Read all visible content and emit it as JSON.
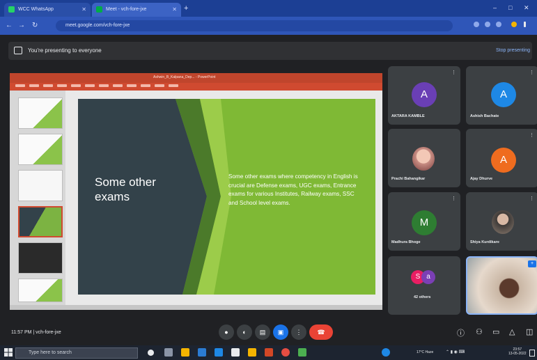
{
  "browser": {
    "tabs": [
      {
        "label": "WCC WhatsApp"
      },
      {
        "label": "Meet - vch-fore-jxe"
      }
    ],
    "url": "meet.google.com/vch-fore-jxe"
  },
  "presenting": {
    "text": "You're presenting to everyone",
    "stop_label": "Stop presenting"
  },
  "powerpoint": {
    "title_text": "Ashwin_B_Kalpana_Dep... - PowerPoint",
    "accent": "#c0452c"
  },
  "slide": {
    "title": "Some other exams",
    "body": "Some other exams where competency in English is crucial are Defense exams, UGC exams, Entrance exams for various Institutes, Railway exams, SSC and School level exams."
  },
  "participants": [
    {
      "name": "AKTARA KAMBLE",
      "initial": "A",
      "color": "#6a3fb5",
      "type": "avatar"
    },
    {
      "name": "Ashish Bachate",
      "initial": "A",
      "color": "#1e88e5",
      "type": "avatar"
    },
    {
      "name": "Prachi Bahangikar",
      "initial": "",
      "color": "#c98e84",
      "type": "photo"
    },
    {
      "name": "Ajay Dhurve",
      "initial": "A",
      "color": "#ef6c1f",
      "type": "avatar"
    },
    {
      "name": "Madhura Bhoge",
      "initial": "M",
      "color": "#2e7d32",
      "type": "avatar"
    },
    {
      "name": "Shiya Kurdikare",
      "initial": "",
      "color": "#8a7a6e",
      "type": "photo"
    },
    {
      "name": "42 others",
      "initial": "S",
      "color": "#e91e63",
      "type": "group",
      "initial2": "a",
      "color2": "#7b3fb5"
    }
  ],
  "meet_controls": {
    "time_code": "11:57 PM | vch-fore-jxe",
    "buttons": [
      "mic-icon",
      "camera-icon",
      "captions-icon",
      "present-icon",
      "more-icon",
      "end-call-icon"
    ],
    "end_color": "#ea4335",
    "present_color": "#1a73e8"
  },
  "taskbar": {
    "search_placeholder": "Type here to search",
    "tray_text": "17°C Haze",
    "time": "23:57",
    "date": "13-05-2022"
  }
}
